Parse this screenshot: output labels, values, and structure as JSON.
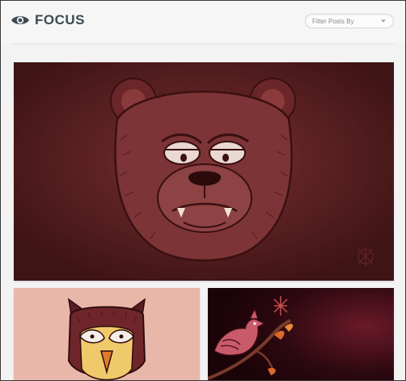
{
  "header": {
    "logo_text": "FOCUS",
    "logo_icon": "eye-icon"
  },
  "filter": {
    "label": "Filter Posts By",
    "icon": "chevron-down-icon"
  },
  "posts": [
    {
      "subject": "bear illustration",
      "background": "#5a1f21"
    },
    {
      "subject": "owl illustration",
      "background": "#e9b7a9"
    },
    {
      "subject": "bird illustration",
      "background": "#2a0710"
    }
  ],
  "colors": {
    "logo_text": "#3d4a52",
    "page_bg": "#f3f3f3"
  }
}
